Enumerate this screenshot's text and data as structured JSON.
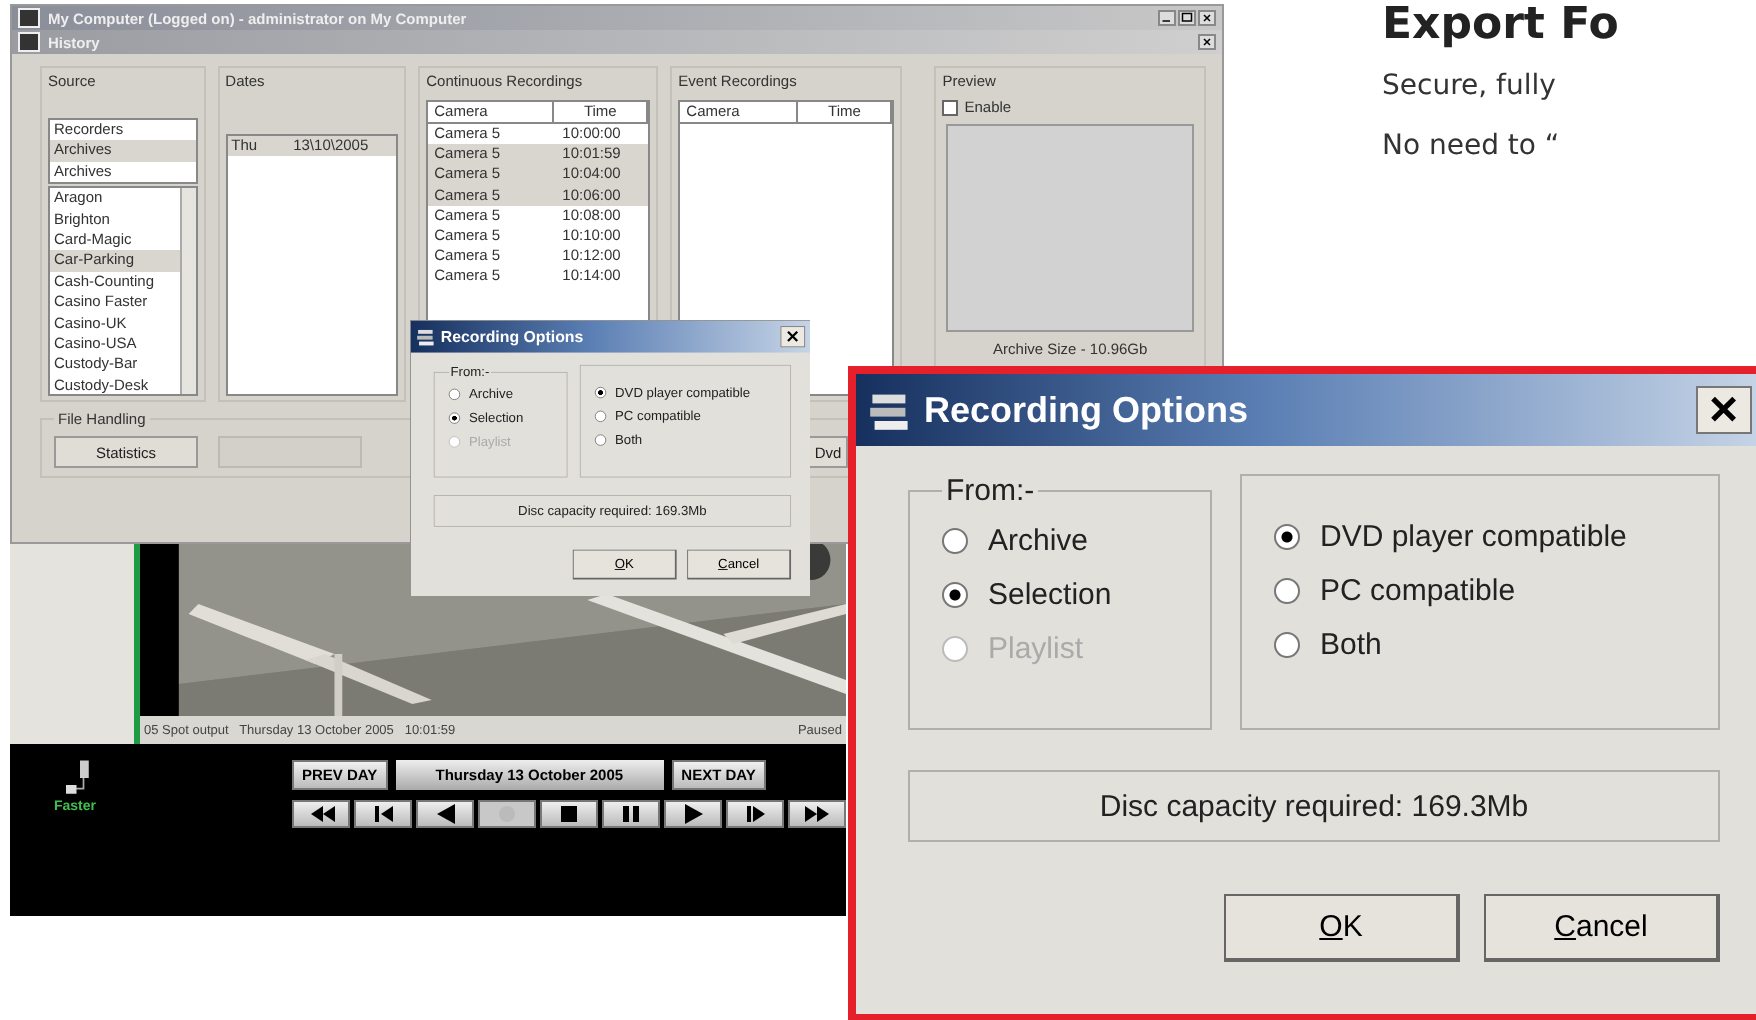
{
  "app_window": {
    "title": "My Computer (Logged on) - administrator on My Computer",
    "subwindow_title": "History",
    "source": {
      "label": "Source",
      "top_items": [
        {
          "text": "Recorders",
          "selected": false
        },
        {
          "text": "Archives",
          "selected": true
        },
        {
          "text": "Archives",
          "selected": false
        }
      ],
      "items": [
        {
          "text": "Aragon",
          "selected": false
        },
        {
          "text": "Brighton",
          "selected": false
        },
        {
          "text": "Card-Magic",
          "selected": false
        },
        {
          "text": "Car-Parking",
          "selected": true
        },
        {
          "text": "Cash-Counting",
          "selected": false
        },
        {
          "text": "Casino Faster",
          "selected": false
        },
        {
          "text": "Casino-UK",
          "selected": false
        },
        {
          "text": "Casino-USA",
          "selected": false
        },
        {
          "text": "Custody-Bar",
          "selected": false
        },
        {
          "text": "Custody-Desk",
          "selected": false
        }
      ]
    },
    "dates": {
      "label": "Dates",
      "rows": [
        {
          "day": "Thu",
          "date": "13\\10\\2005",
          "selected": true
        }
      ]
    },
    "continuous": {
      "label": "Continuous Recordings",
      "columns": [
        "Camera",
        "Time"
      ],
      "rows": [
        {
          "camera": "Camera 5",
          "time": "10:00:00",
          "selected": false
        },
        {
          "camera": "Camera 5",
          "time": "10:01:59",
          "selected": true
        },
        {
          "camera": "Camera 5",
          "time": "10:04:00",
          "selected": true
        },
        {
          "camera": "Camera 5",
          "time": "10:06:00",
          "selected": true
        },
        {
          "camera": "Camera 5",
          "time": "10:08:00",
          "selected": false
        },
        {
          "camera": "Camera 5",
          "time": "10:10:00",
          "selected": false
        },
        {
          "camera": "Camera 5",
          "time": "10:12:00",
          "selected": false
        },
        {
          "camera": "Camera 5",
          "time": "10:14:00",
          "selected": false
        }
      ]
    },
    "event": {
      "label": "Event Recordings",
      "columns": [
        "Camera",
        "Time"
      ]
    },
    "preview": {
      "label": "Preview",
      "enable": {
        "label": "Enable",
        "checked": false
      },
      "archive_size": "Archive Size - 10.96Gb"
    },
    "file_handling": {
      "label": "File Handling",
      "buttons": [
        {
          "label": "Statistics",
          "disabled": false
        },
        {
          "disabled": true
        },
        {
          "label": "Dvd",
          "disabled": false
        }
      ]
    }
  },
  "small_dialog": {
    "title": "Recording Options",
    "from_label": "From:-",
    "sources": [
      {
        "label": "Archive",
        "selected": false,
        "disabled": false
      },
      {
        "label": "Selection",
        "selected": true,
        "disabled": false
      },
      {
        "label": "Playlist",
        "selected": false,
        "disabled": true
      }
    ],
    "formats": [
      {
        "label": "DVD player compatible",
        "selected": true
      },
      {
        "label": "PC compatible",
        "selected": false
      },
      {
        "label": "Both",
        "selected": false
      }
    ],
    "capacity": "Disc capacity required: 169.3Mb",
    "buttons": [
      {
        "label": "OK"
      },
      {
        "label": "Cancel"
      }
    ]
  },
  "player": {
    "status": "05 Spot output   Thursday 13 October 2005   10:01:59",
    "state": "Paused",
    "speed": "Faster",
    "prev": "PREV DAY",
    "date": "Thursday 13 October 2005",
    "next": "NEXT DAY",
    "transport": [
      {
        "kind": "rewind",
        "disabled": false
      },
      {
        "kind": "step-back",
        "disabled": false
      },
      {
        "kind": "reverse",
        "disabled": false
      },
      {
        "kind": "record",
        "disabled": true
      },
      {
        "kind": "stop",
        "disabled": false
      },
      {
        "kind": "pause",
        "disabled": false
      },
      {
        "kind": "play",
        "disabled": false
      },
      {
        "kind": "step-forward",
        "disabled": false
      },
      {
        "kind": "fast-forward",
        "disabled": false
      }
    ]
  },
  "page": {
    "heading": "Export Fo",
    "lines": [
      "Secure, fully",
      "No need to “"
    ]
  },
  "zoom_dialog": {
    "title": "Recording Options",
    "from_label": "From:-",
    "sources": [
      {
        "label": "Archive",
        "selected": false,
        "disabled": false
      },
      {
        "label": "Selection",
        "selected": true,
        "disabled": false
      },
      {
        "label": "Playlist",
        "selected": false,
        "disabled": true
      }
    ],
    "formats": [
      {
        "label": "DVD player compatible",
        "selected": true
      },
      {
        "label": "PC compatible",
        "selected": false
      },
      {
        "label": "Both",
        "selected": false
      }
    ],
    "capacity": "Disc capacity required: 169.3Mb",
    "buttons": [
      {
        "label": "OK"
      },
      {
        "label": "Cancel"
      }
    ]
  }
}
